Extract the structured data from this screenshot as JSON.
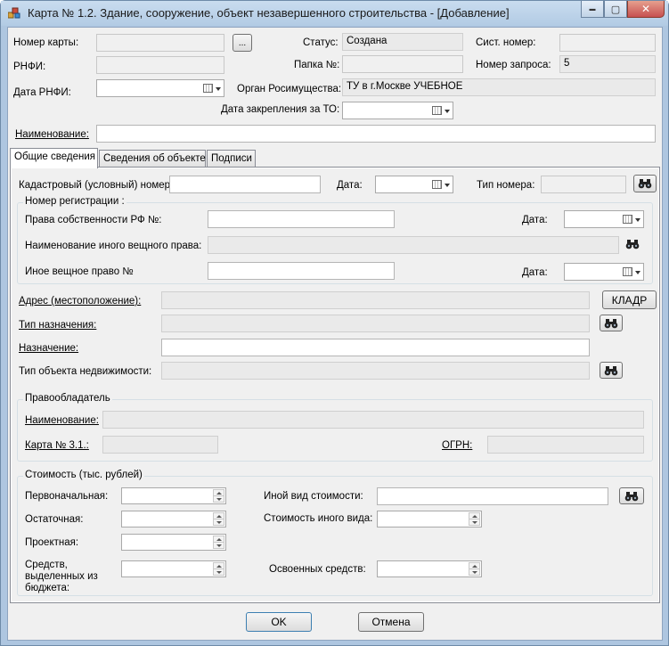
{
  "window": {
    "title": "Карта № 1.2. Здание, сооружение, объект незавершенного строительства - [Добавление]",
    "controls": {
      "minimize": "▬",
      "maximize": "▢",
      "close": "✕"
    }
  },
  "header": {
    "card_number_label": "Номер карты:",
    "card_number_value": "",
    "browse_label": "...",
    "status_label": "Статус:",
    "status_value": "Создана",
    "sys_number_label": "Сист. номер:",
    "sys_number_value": "",
    "rnfi_label": "РНФИ:",
    "rnfi_value": "",
    "folder_label": "Папка №:",
    "folder_value": "",
    "request_number_label": "Номер запроса:",
    "request_number_value": "5",
    "rnfi_date_label": "Дата РНФИ:",
    "organ_label": "Орган Росимущества:",
    "organ_value": "ТУ в г.Москве УЧЕБНОЕ",
    "assign_date_label": "Дата закрепления за ТО:",
    "name_label": "Наименование:",
    "name_value": ""
  },
  "tabs": [
    {
      "label": "Общие сведения"
    },
    {
      "label": "Сведения об объекте"
    },
    {
      "label": "Подписи"
    }
  ],
  "general": {
    "cadastral_label": "Кадастровый (условный) номер:",
    "cadastral_value": "",
    "date_label": "Дата:",
    "number_type_label": "Тип номера:",
    "number_type_value": "",
    "registration": {
      "title": "Номер регистрации :",
      "rf_rights_label": "Права собственности РФ №:",
      "rf_rights_value": "",
      "rf_date_label": "Дата:",
      "other_right_name_label": "Наименование иного вещного права:",
      "other_right_name_value": "",
      "other_right_label": "Иное вещное право  №",
      "other_right_value": "",
      "other_date_label": "Дата:"
    },
    "address_label": "Адрес (местоположение):",
    "address_value": "",
    "kladr_label": "КЛАДР",
    "purpose_type_label": "Тип назначения:",
    "purpose_type_value": "",
    "purpose_label": "Назначение:",
    "purpose_value": "",
    "realty_type_label": "Тип объекта недвижимости:",
    "realty_type_value": "",
    "owner": {
      "title": "Правообладатель",
      "name_label": "Наименование:",
      "name_value": "",
      "card_label": "Карта № 3.1.:",
      "card_value": "",
      "ogrn_label": "ОГРН:",
      "ogrn_value": ""
    },
    "cost": {
      "title": "Стоимость (тыс. рублей)",
      "initial_label": "Первоначальная:",
      "residual_label": "Остаточная:",
      "project_label": "Проектная:",
      "budget_label": "Средств, выделенных из бюджета:",
      "other_kind_label": "Иной вид стоимости:",
      "other_kind_value": "",
      "other_cost_label": "Стоимость иного вида:",
      "mastered_label": "Освоенных средств:"
    }
  },
  "footer": {
    "ok_label": "OK",
    "cancel_label": "Отмена"
  },
  "colors": {
    "window_frame": "#aec6e0",
    "client_bg": "#f0f0f0",
    "close_button": "#c75050"
  }
}
